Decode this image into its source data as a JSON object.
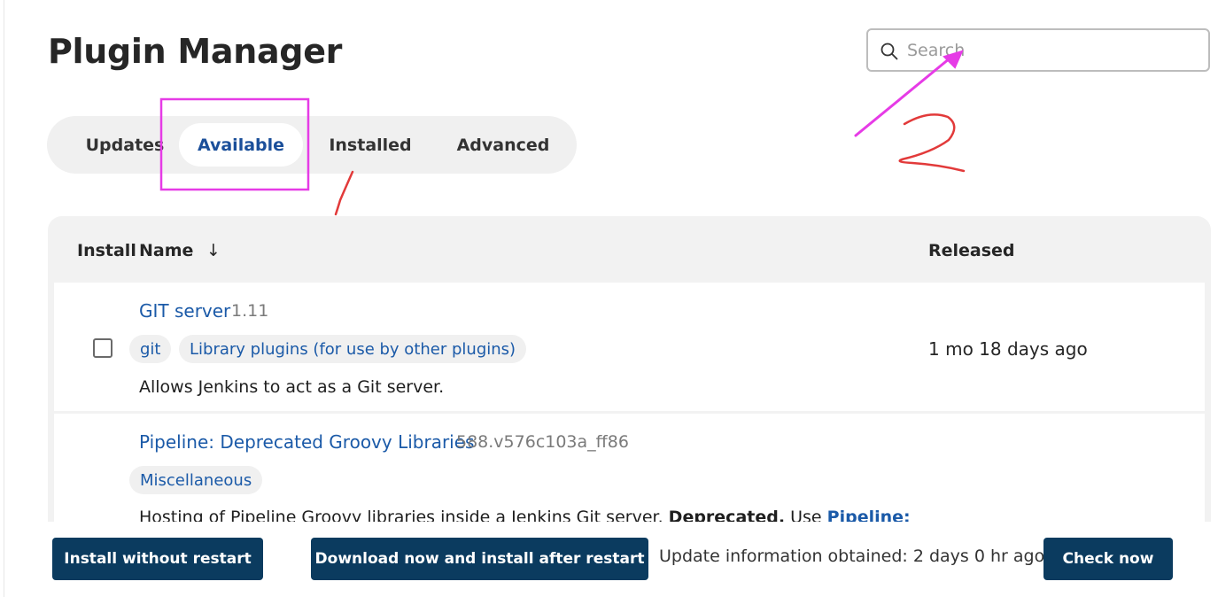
{
  "page": {
    "title": "Plugin Manager"
  },
  "search": {
    "placeholder": "Search",
    "value": ""
  },
  "tabs": [
    {
      "label": "Updates",
      "active": false
    },
    {
      "label": "Available",
      "active": true
    },
    {
      "label": "Installed",
      "active": false
    },
    {
      "label": "Advanced",
      "active": false
    }
  ],
  "table": {
    "headers": {
      "install": "Install",
      "name": "Name",
      "sort_indicator": "↓",
      "released": "Released"
    },
    "rows": [
      {
        "name": "GIT server",
        "version": "1.11",
        "tags": [
          "git",
          "Library plugins (for use by other plugins)"
        ],
        "description": "Allows Jenkins to act as a Git server.",
        "released": "1 mo 18 days ago",
        "checked": false
      },
      {
        "name": "Pipeline: Deprecated Groovy Libraries",
        "version": "588.v576c103a_ff86",
        "tags": [
          "Miscellaneous"
        ],
        "description_prefix": "Hosting of Pipeline Groovy libraries inside a Jenkins Git server.",
        "description_bold": "Deprecated.",
        "description_use": "Use",
        "description_link": "Pipeline:",
        "released": ""
      }
    ]
  },
  "footer": {
    "install_without_restart": "Install without restart",
    "download_install_after_restart": "Download now and install after restart",
    "update_info": "Update information obtained: 2 days 0 hr ago",
    "check_now": "Check now"
  },
  "annotations": {
    "label_1": "1",
    "label_2": "2",
    "highlight_color": "#e63be6",
    "handwriting_color": "#e23a3a"
  },
  "colors": {
    "accent_link": "#1b5aa8",
    "primary_button": "#0b3b5f",
    "tab_active_text": "#1b4f9a"
  }
}
